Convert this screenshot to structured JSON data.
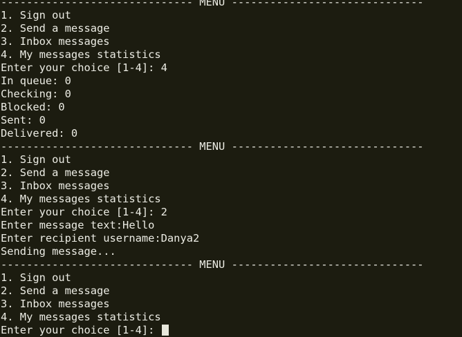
{
  "terminal": {
    "lines": [
      "------------------------------ MENU ------------------------------",
      "1. Sign out",
      "2. Send a message",
      "3. Inbox messages",
      "4. My messages statistics",
      "Enter your choice [1-4]: 4",
      "In queue: 0",
      "Checking: 0",
      "Blocked: 0",
      "Sent: 0",
      "Delivered: 0",
      "------------------------------ MENU ------------------------------",
      "1. Sign out",
      "2. Send a message",
      "3. Inbox messages",
      "4. My messages statistics",
      "Enter your choice [1-4]: 2",
      "Enter message text:Hello",
      "Enter recipient username:Danya2",
      "Sending message...",
      "------------------------------ MENU ------------------------------",
      "1. Sign out",
      "2. Send a message",
      "3. Inbox messages",
      "4. My messages statistics",
      "Enter your choice [1-4]: "
    ],
    "colors": {
      "background": "#1c1c10",
      "foreground": "#ecece4",
      "cursor": "#e8e8dc"
    }
  }
}
